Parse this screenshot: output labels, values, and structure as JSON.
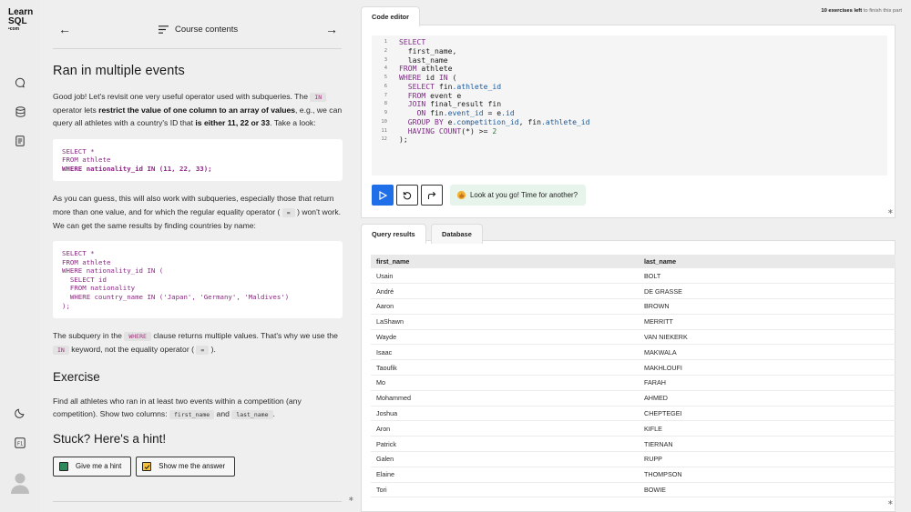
{
  "brand": {
    "line1": "Learn",
    "line2": "SQL",
    "line3": "•com"
  },
  "nav": {
    "title": "Course contents"
  },
  "lesson": {
    "heading": "Ran in multiple events",
    "p1_a": "Good job! Let's revisit one very useful operator used with subqueries. The ",
    "p1_code": "IN",
    "p1_b": " operator lets ",
    "p1_bold1": "restrict the value of one column to an array of values",
    "p1_c": ", e.g., we can query all athletes with a country's ID that ",
    "p1_bold2": "is either 11, 22 or 33",
    "p1_d": ". Take a look:",
    "code1_l1": "SELECT *",
    "code1_l2": "FROM athlete",
    "code1_l3": "WHERE nationality_id IN (11, 22, 33);",
    "p2_a": "As you can guess, this will also work with subqueries, especially those that return more than one value, and for which the regular equality operator ( ",
    "p2_code": "=",
    "p2_b": " ) won't work. We can get the same results by finding countries by name:",
    "code2": [
      "SELECT *",
      "FROM athlete",
      "WHERE nationality_id IN (",
      "  SELECT id",
      "  FROM nationality",
      "  WHERE country_name IN ('Japan', 'Germany', 'Maldives')",
      ");"
    ],
    "p3_a": "The subquery in the ",
    "p3_code1": "WHERE",
    "p3_b": " clause returns multiple values. That's why we use the ",
    "p3_code2": "IN",
    "p3_c": " keyword, not the equality operator ( ",
    "p3_code3": "=",
    "p3_d": " ).",
    "exercise_heading": "Exercise",
    "p4_a": "Find all athletes who ran in at least two events within a competition (any competition). Show two columns: ",
    "p4_code1": "first_name",
    "p4_b": " and ",
    "p4_code2": "last_name",
    "p4_c": ".",
    "hint_heading": "Stuck? Here's a hint!",
    "hint_button": "Give me a hint",
    "answer_button": "Show me the answer"
  },
  "editor": {
    "tab": "Code editor",
    "exercises_left_bold": "10 exercises left",
    "exercises_left_rest": " to finish this part",
    "line_numbers": [
      "1",
      "2",
      "3",
      "4",
      "5",
      "6",
      "7",
      "8",
      "9",
      "10",
      "11",
      "12"
    ],
    "feedback": "Look at you go! Time for another?"
  },
  "results": {
    "tab_results": "Query results",
    "tab_database": "Database",
    "columns": [
      "first_name",
      "last_name"
    ],
    "rows": [
      [
        "Usain",
        "BOLT"
      ],
      [
        "André",
        "DE GRASSE"
      ],
      [
        "Aaron",
        "BROWN"
      ],
      [
        "LaShawn",
        "MERRITT"
      ],
      [
        "Wayde",
        "VAN NIEKERK"
      ],
      [
        "Isaac",
        "MAKWALA"
      ],
      [
        "Taoufik",
        "MAKHLOUFI"
      ],
      [
        "Mo",
        "FARAH"
      ],
      [
        "Mohammed",
        "AHMED"
      ],
      [
        "Joshua",
        "CHEPTEGEI"
      ],
      [
        "Aron",
        "KIFLE"
      ],
      [
        "Patrick",
        "TIERNAN"
      ],
      [
        "Galen",
        "RUPP"
      ],
      [
        "Elaine",
        "THOMPSON"
      ],
      [
        "Tori",
        "BOWIE"
      ]
    ]
  }
}
